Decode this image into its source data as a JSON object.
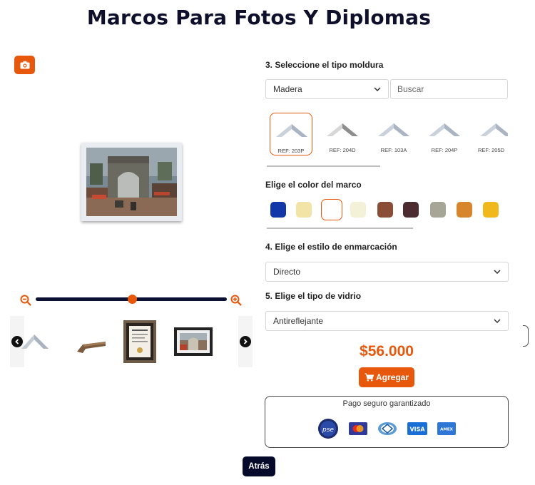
{
  "page": {
    "title": "Marcos Para Fotos Y Diplomas"
  },
  "colors": {
    "accent": "#e8580c",
    "navy": "#0c1033"
  },
  "zoom": {
    "level_fraction": 0.5
  },
  "steps": {
    "moulding": {
      "label": "3. Seleccione el tipo moldura",
      "category_selected": "Madera",
      "search_placeholder": "Buscar",
      "items": [
        {
          "ref": "REF: 203P"
        },
        {
          "ref": "REF: 204D"
        },
        {
          "ref": "REF: 103A"
        },
        {
          "ref": "REF: 204P"
        },
        {
          "ref": "REF: 205D"
        }
      ]
    },
    "color": {
      "label": "Elige el color del marco",
      "swatches": [
        {
          "hex": "#1237a8"
        },
        {
          "hex": "#f2e4a6"
        },
        {
          "hex": "#ffffff"
        },
        {
          "hex": "#f4f1d9"
        },
        {
          "hex": "#8a4e38"
        },
        {
          "hex": "#4b2a30"
        },
        {
          "hex": "#a6a696"
        },
        {
          "hex": "#d7862e"
        },
        {
          "hex": "#f0b81a"
        }
      ],
      "selected_index": 2
    },
    "style": {
      "label": "4. Elige el estilo de enmarcación",
      "selected": "Directo"
    },
    "glass": {
      "label": "5. Elige el tipo de vidrio",
      "selected": "Antireflejante"
    }
  },
  "price": "$56.000",
  "add_button": "Agregar",
  "secure": {
    "text": "Pago seguro garantizado",
    "methods": [
      "pse",
      "mastercard",
      "diners",
      "VISA",
      "AMEX"
    ]
  },
  "back_button": "Atrás"
}
